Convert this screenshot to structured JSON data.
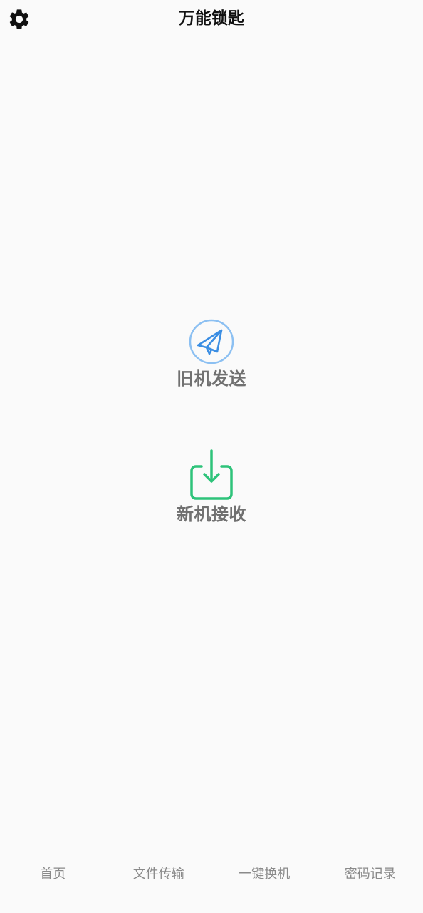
{
  "header": {
    "title": "万能锁匙",
    "settings_icon": "gear-icon"
  },
  "actions": [
    {
      "label": "旧机发送",
      "icon": "paper-plane-icon",
      "color": "#3b8ee3"
    },
    {
      "label": "新机接收",
      "icon": "download-tray-icon",
      "color": "#2ec37a"
    }
  ],
  "bottom_nav": {
    "items": [
      {
        "label": "首页"
      },
      {
        "label": "文件传输"
      },
      {
        "label": "一键换机"
      },
      {
        "label": "密码记录"
      }
    ]
  },
  "colors": {
    "background": "#fafafa",
    "title_text": "#111111",
    "action_text": "#707070",
    "nav_text": "#8a8a8a"
  }
}
